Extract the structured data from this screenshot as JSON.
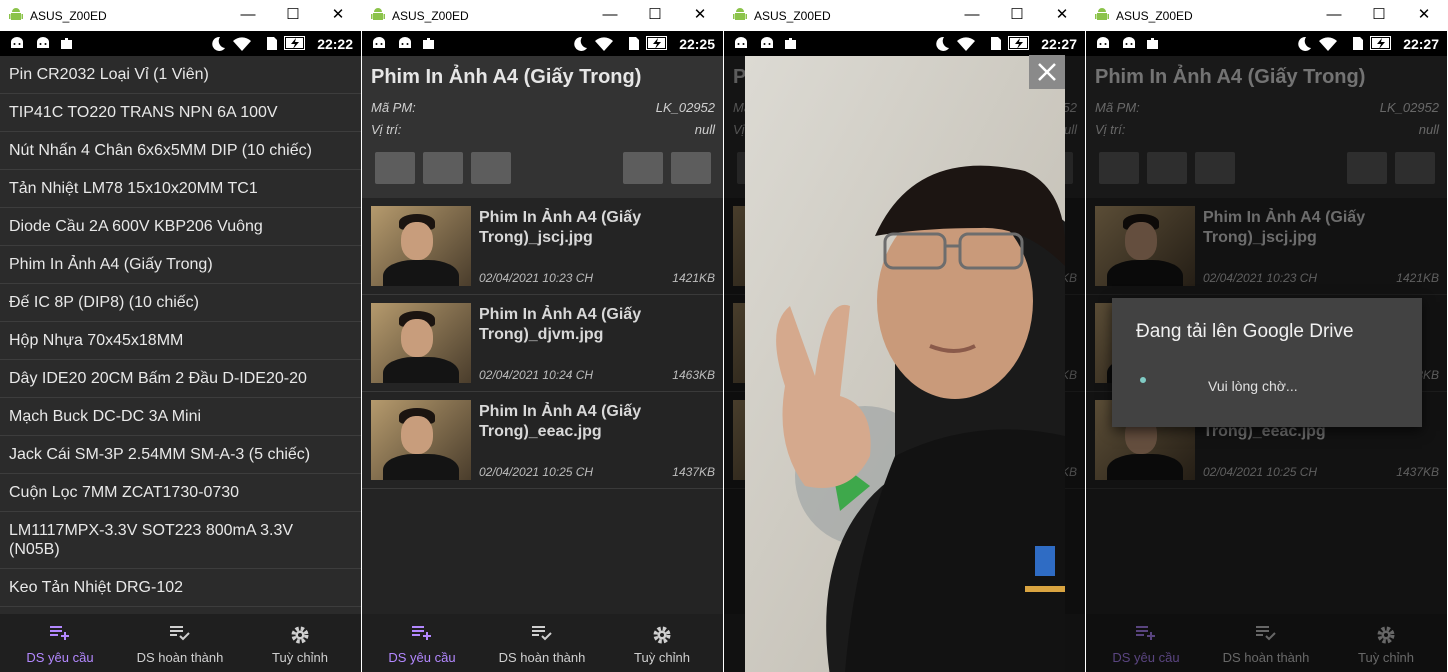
{
  "window_title": "ASUS_Z00ED",
  "window_controls": {
    "minimize": "—",
    "maximize": "☐",
    "close": "✕"
  },
  "status_times": [
    "22:22",
    "22:25",
    "22:27",
    "22:27"
  ],
  "list_items": [
    {
      "label": "Pin CR2032 Loại Vỉ (1 Viên)",
      "eye": true
    },
    {
      "label": "TIP41C TO220 TRANS NPN 6A 100V",
      "eye": true
    },
    {
      "label": "Nút Nhấn 4 Chân 6x6x5MM DIP (10 chiếc)",
      "eye": true
    },
    {
      "label": "Tản Nhiệt LM78 15x10x20MM TC1",
      "eye": true
    },
    {
      "label": "Diode Cầu 2A 600V KBP206 Vuông",
      "eye": false
    },
    {
      "label": "Phim In Ảnh A4 (Giấy Trong)",
      "eye": true
    },
    {
      "label": "Đế IC 8P (DIP8) (10 chiếc)",
      "eye": false
    },
    {
      "label": "Hộp Nhựa 70x45x18MM",
      "eye": false
    },
    {
      "label": "Dây IDE20 20CM Bấm 2 Đầu D-IDE20-20",
      "eye": false
    },
    {
      "label": "Mạch Buck DC-DC 3A Mini",
      "eye": false
    },
    {
      "label": "Jack Cái SM-3P 2.54MM SM-A-3 (5 chiếc)",
      "eye": false
    },
    {
      "label": "Cuộn Lọc 7MM ZCAT1730-0730",
      "eye": false
    },
    {
      "label": "LM1117MPX-3.3V SOT223 800mA 3.3V (N05B)",
      "eye": false
    },
    {
      "label": "Keo Tản Nhiệt DRG-102",
      "eye": false
    }
  ],
  "nav": [
    {
      "label": "DS yêu cầu",
      "icon": "playlist-add-icon",
      "active": true
    },
    {
      "label": "DS hoàn thành",
      "icon": "playlist-check-icon",
      "active": false
    },
    {
      "label": "Tuỳ chỉnh",
      "icon": "gear-icon",
      "active": false
    }
  ],
  "detail": {
    "title": "Phim In Ảnh A4 (Giấy Trong)",
    "ma_pm_label": "Mã PM:",
    "ma_pm_value": "LK_02952",
    "vi_tri_label": "Vị trí:",
    "vi_tri_value": "null"
  },
  "files": [
    {
      "name": "Phim In Ảnh A4 (Giấy Trong)_jscj.jpg",
      "date": "02/04/2021 10:23 CH",
      "size": "1421KB"
    },
    {
      "name": "Phim In Ảnh A4 (Giấy Trong)_djvm.jpg",
      "date": "02/04/2021 10:24 CH",
      "size": "1463KB"
    },
    {
      "name": "Phim In Ảnh A4 (Giấy Trong)_eeac.jpg",
      "date": "02/04/2021 10:25 CH",
      "size": "1437KB"
    }
  ],
  "dialog": {
    "title": "Đang tải lên Google Drive",
    "message": "Vui lòng chờ..."
  },
  "colors": {
    "accent": "#b388ff",
    "background": "#2b2b2b",
    "toolbar_button": "#5d5d5d"
  }
}
